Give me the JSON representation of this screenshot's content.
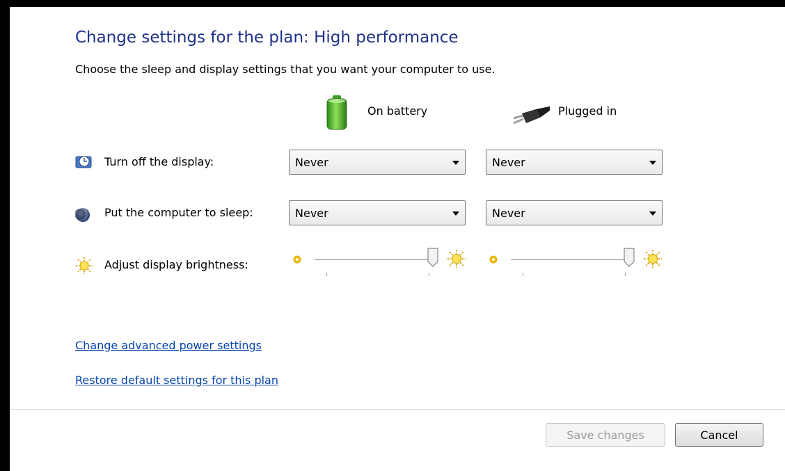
{
  "title": "Change settings for the plan: High performance",
  "subtitle": "Choose the sleep and display settings that you want your computer to use.",
  "columns": {
    "battery": "On battery",
    "plugged": "Plugged in"
  },
  "rows": {
    "display": {
      "label": "Turn off the display:",
      "battery_value": "Never",
      "plugged_value": "Never"
    },
    "sleep": {
      "label": "Put the computer to sleep:",
      "battery_value": "Never",
      "plugged_value": "Never"
    },
    "brightness": {
      "label": "Adjust display brightness:",
      "battery_level": 1.0,
      "plugged_level": 1.0
    }
  },
  "links": {
    "advanced": "Change advanced power settings",
    "restore": "Restore default settings for this plan"
  },
  "buttons": {
    "save": "Save changes",
    "save_enabled": false,
    "cancel": "Cancel"
  },
  "colors": {
    "title": "#1e3287",
    "link": "#0645ad"
  }
}
